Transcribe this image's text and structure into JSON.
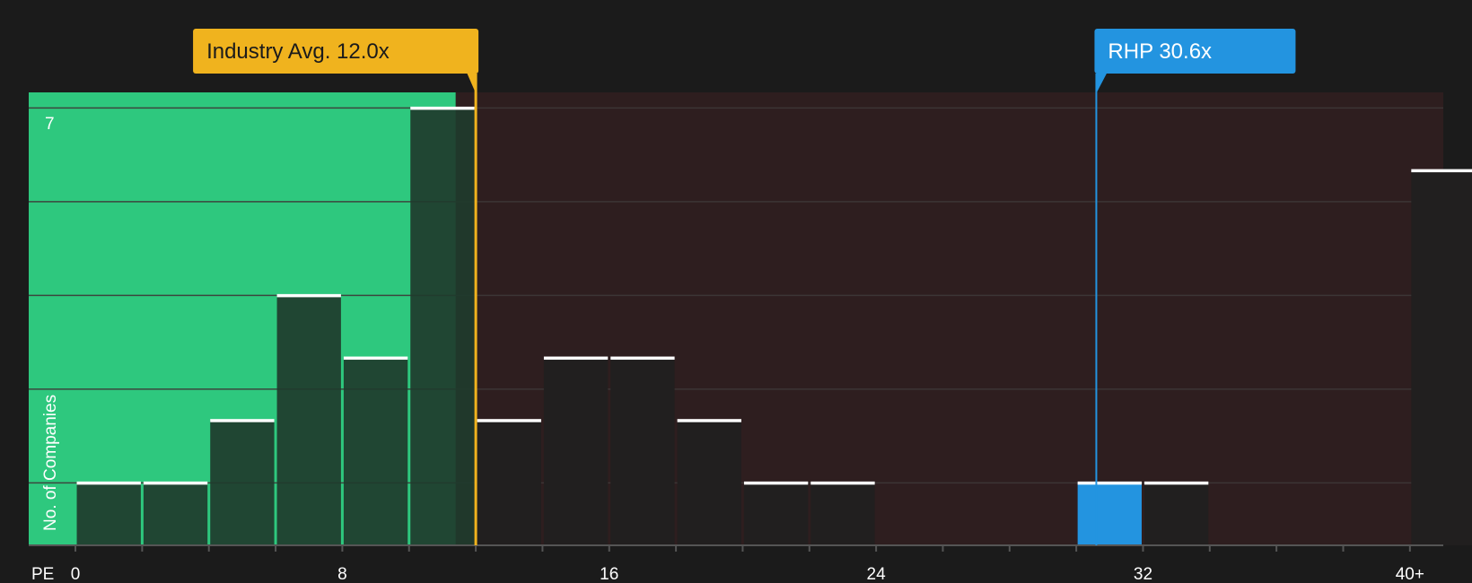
{
  "chart_data": {
    "type": "bar",
    "xlabel": "PE",
    "ylabel": "No. of Companies",
    "x_ticks": [
      "0",
      "8",
      "16",
      "24",
      "32",
      "40+"
    ],
    "x_tick_values": [
      0,
      8,
      16,
      24,
      32,
      40
    ],
    "y_tick_labels": [
      "7"
    ],
    "xlim": [
      -1.4,
      41
    ],
    "ylim": [
      0,
      7.25
    ],
    "bin_width": 2,
    "bins": [
      {
        "x0": 0,
        "count": 1
      },
      {
        "x0": 2,
        "count": 1
      },
      {
        "x0": 4,
        "count": 2
      },
      {
        "x0": 6,
        "count": 4
      },
      {
        "x0": 8,
        "count": 3
      },
      {
        "x0": 10,
        "count": 7
      },
      {
        "x0": 12,
        "count": 2
      },
      {
        "x0": 14,
        "count": 3
      },
      {
        "x0": 16,
        "count": 3
      },
      {
        "x0": 18,
        "count": 2
      },
      {
        "x0": 20,
        "count": 1
      },
      {
        "x0": 22,
        "count": 1
      },
      {
        "x0": 24,
        "count": 0
      },
      {
        "x0": 26,
        "count": 0
      },
      {
        "x0": 28,
        "count": 0
      },
      {
        "x0": 30,
        "count": 1,
        "highlight": true
      },
      {
        "x0": 32,
        "count": 1
      },
      {
        "x0": 34,
        "count": 0
      },
      {
        "x0": 36,
        "count": 0
      },
      {
        "x0": 38,
        "count": 0
      },
      {
        "x0": 40,
        "count": 6
      }
    ],
    "grid": true,
    "markers": [
      {
        "name": "industry_avg",
        "label": "Industry Avg. 12.0x",
        "value": 12.0,
        "color": "#f0b31e",
        "text_color": "#1b1b1b"
      },
      {
        "name": "company",
        "label": "RHP 30.6x",
        "value": 30.6,
        "color": "#2394e0",
        "text_color": "#ffffff"
      }
    ],
    "regions": [
      {
        "name": "below_average",
        "from": -1.4,
        "to": 11.4,
        "color": "#2ec87e"
      },
      {
        "name": "above_average",
        "from": 11.4,
        "to": 41,
        "color": "#2e1e1f"
      }
    ],
    "colors": {
      "background": "#1b1b1b",
      "bar_green": "#1f3b2d",
      "bar_dark": "#211f1f",
      "bar_highlight": "#2394e0",
      "cap": "#ffffff",
      "grid": "#3e3838",
      "axis": "#555555"
    }
  }
}
